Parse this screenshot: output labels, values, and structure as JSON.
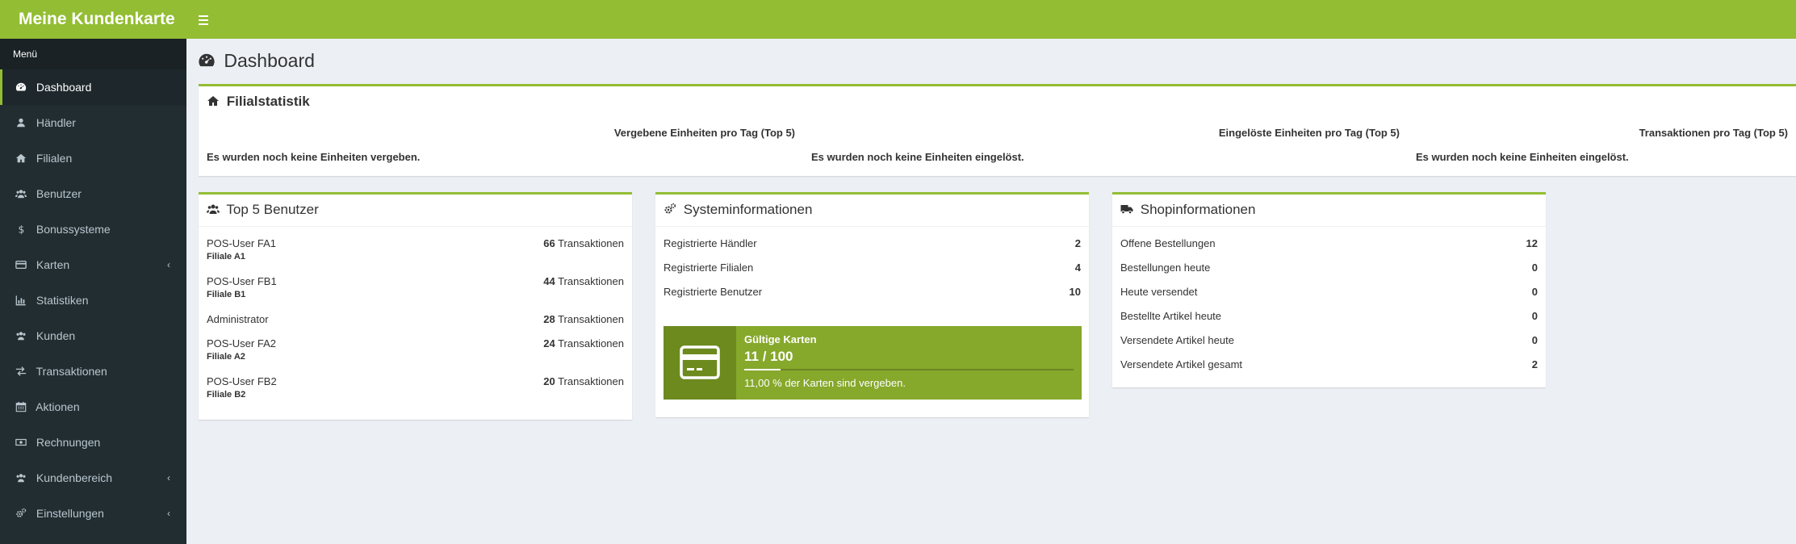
{
  "header": {
    "brand": "Meine Kundenkarte"
  },
  "sidebar": {
    "menu_label": "Menü",
    "items": [
      {
        "label": "Dashboard",
        "icon": "dashboard-icon"
      },
      {
        "label": "Händler",
        "icon": "user-icon"
      },
      {
        "label": "Filialen",
        "icon": "home-icon"
      },
      {
        "label": "Benutzer",
        "icon": "users-icon"
      },
      {
        "label": "Bonussysteme",
        "icon": "dollar-icon"
      },
      {
        "label": "Karten",
        "icon": "credit-card-icon"
      },
      {
        "label": "Statistiken",
        "icon": "bar-chart-icon"
      },
      {
        "label": "Kunden",
        "icon": "users-icon"
      },
      {
        "label": "Transaktionen",
        "icon": "exchange-icon"
      },
      {
        "label": "Aktionen",
        "icon": "calendar-icon"
      },
      {
        "label": "Rechnungen",
        "icon": "money-icon"
      },
      {
        "label": "Kundenbereich",
        "icon": "users-icon"
      },
      {
        "label": "Einstellungen",
        "icon": "gears-icon"
      }
    ]
  },
  "page": {
    "title": "Dashboard"
  },
  "filialstatistik": {
    "title": "Filialstatistik",
    "columns": [
      {
        "header": "Vergebene Einheiten pro Tag (Top 5)",
        "message": "Es wurden noch keine Einheiten vergeben."
      },
      {
        "header": "Eingelöste Einheiten pro Tag (Top 5)",
        "message": "Es wurden noch keine Einheiten eingelöst."
      },
      {
        "header": "Transaktionen pro Tag (Top 5)",
        "message": "Es wurden noch keine Einheiten eingelöst."
      }
    ]
  },
  "top_users": {
    "title": "Top 5 Benutzer",
    "unit": "Transaktionen",
    "rows": [
      {
        "name": "POS-User FA1",
        "branch": "Filiale A1",
        "count": "66"
      },
      {
        "name": "POS-User FB1",
        "branch": "Filiale B1",
        "count": "44"
      },
      {
        "name": "Administrator",
        "branch": "",
        "count": "28"
      },
      {
        "name": "POS-User FA2",
        "branch": "Filiale A2",
        "count": "24"
      },
      {
        "name": "POS-User FB2",
        "branch": "Filiale B2",
        "count": "20"
      }
    ]
  },
  "system_info": {
    "title": "Systeminformationen",
    "rows": [
      {
        "label": "Registrierte Händler",
        "value": "2"
      },
      {
        "label": "Registrierte Filialen",
        "value": "4"
      },
      {
        "label": "Registrierte Benutzer",
        "value": "10"
      }
    ],
    "cards": {
      "label": "Gültige Karten",
      "value": "11 / 100",
      "progress_fraction": 0.11,
      "description": "11,00 % der Karten sind vergeben."
    }
  },
  "shop_info": {
    "title": "Shopinformationen",
    "rows": [
      {
        "label": "Offene Bestellungen",
        "value": "12"
      },
      {
        "label": "Bestellungen heute",
        "value": "0"
      },
      {
        "label": "Heute versendet",
        "value": "0"
      },
      {
        "label": "Bestellte Artikel heute",
        "value": "0"
      },
      {
        "label": "Versendete Artikel heute",
        "value": "0"
      },
      {
        "label": "Versendete Artikel gesamt",
        "value": "2"
      }
    ]
  },
  "colors": {
    "brand_green": "#93bd33",
    "sidebar_bg": "#222d32",
    "card_panel": "#86a82b"
  }
}
